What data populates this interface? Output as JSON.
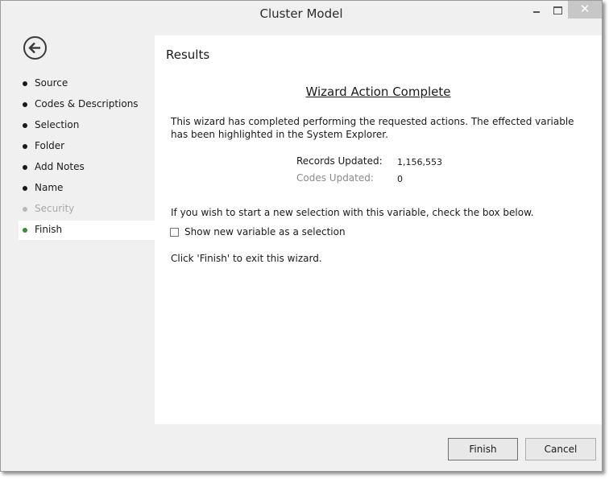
{
  "window": {
    "title": "Cluster Model",
    "close_glyph": "✕"
  },
  "sidebar": {
    "back_icon": "back-arrow-icon",
    "items": [
      {
        "label": "Source",
        "state": "done"
      },
      {
        "label": "Codes & Descriptions",
        "state": "done"
      },
      {
        "label": "Selection",
        "state": "done"
      },
      {
        "label": "Folder",
        "state": "done"
      },
      {
        "label": "Add Notes",
        "state": "done"
      },
      {
        "label": "Name",
        "state": "done"
      },
      {
        "label": "Security",
        "state": "disabled"
      },
      {
        "label": "Finish",
        "state": "active"
      }
    ]
  },
  "main": {
    "section_title": "Results",
    "heading": "Wizard Action Complete",
    "description": "This wizard has completed performing the requested actions. The effected variable has been highlighted in the System Explorer.",
    "stats": {
      "records_label": "Records Updated:",
      "records_value": "1,156,553",
      "codes_label": "Codes Updated:",
      "codes_value": "0"
    },
    "new_selection_text": "If you wish to start a new selection with this variable, check the box below.",
    "checkbox_label": "Show new variable as a selection",
    "checkbox_checked": false,
    "exit_text": "Click 'Finish' to exit this wizard."
  },
  "footer": {
    "finish_label": "Finish",
    "cancel_label": "Cancel"
  },
  "colors": {
    "active_dot": "#3b8a3b",
    "window_bg": "#f0f0f0",
    "close_button": "#c7c7c7"
  }
}
